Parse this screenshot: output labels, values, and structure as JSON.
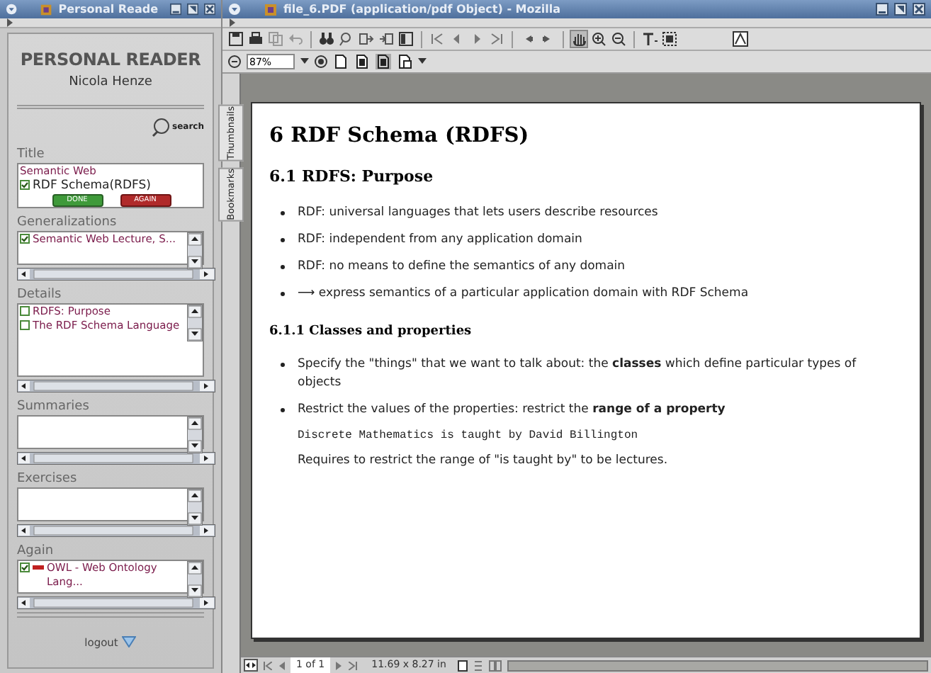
{
  "reader_window": {
    "title": "Personal Reade",
    "app_title": "PERSONAL READER",
    "author": "Nicola Henze",
    "search_label": "search",
    "sections": [
      {
        "heading": "Title",
        "kind": "title",
        "items": [
          {
            "text": "Semantic Web",
            "kind": "plain"
          },
          {
            "text": "RDF Schema(RDFS)",
            "kind": "check",
            "checked": true
          }
        ],
        "buttons": [
          "DONE",
          "AGAIN"
        ]
      },
      {
        "heading": "Generalizations",
        "kind": "list",
        "items": [
          {
            "text": "Semantic Web Lecture, S...",
            "kind": "check",
            "checked": true
          }
        ]
      },
      {
        "heading": "Details",
        "kind": "tall",
        "items": [
          {
            "text": "RDFS: Purpose",
            "kind": "check",
            "checked": false
          },
          {
            "text": "The RDF Schema Language",
            "kind": "check",
            "checked": false
          }
        ]
      },
      {
        "heading": "Summaries",
        "kind": "list"
      },
      {
        "heading": "Exercises",
        "kind": "list"
      },
      {
        "heading": "Again",
        "kind": "list",
        "items": [
          {
            "text": "OWL - Web Ontology Lang...",
            "kind": "flagged",
            "checked": true
          }
        ]
      }
    ],
    "logout": "logout"
  },
  "pdf_window": {
    "title": "file_6.PDF (application/pdf Object) - Mozilla",
    "zoom": "87%",
    "side_tabs": [
      "Thumbnails",
      "Bookmarks"
    ],
    "page": [
      {
        "kind": "h1",
        "text": "6  RDF Schema (RDFS)"
      },
      {
        "kind": "h2",
        "text": "6.1  RDFS: Purpose"
      },
      {
        "kind": "bullet",
        "text": "RDF: universal languages that lets users describe resources"
      },
      {
        "kind": "bullet",
        "text": "RDF: independent from any application domain"
      },
      {
        "kind": "bullet",
        "text": "RDF: no means to define the semantics of any domain"
      },
      {
        "kind": "bullet",
        "text": "⟶ express semantics of a particular application domain with RDF Schema"
      },
      {
        "kind": "h3",
        "text": "6.1.1  Classes and properties"
      },
      {
        "kind": "bullet",
        "text": "Specify the \"things\" that we want to talk about: the **classes** which define particular types of objects"
      },
      {
        "kind": "bullet",
        "text": "Restrict the values of the properties: restrict the **range of a property**"
      },
      {
        "kind": "mono",
        "text": "Discrete Mathematics is taught by David Billington"
      },
      {
        "kind": "para",
        "text": "Requires to restrict the range of \"is taught by\" to be lectures."
      }
    ],
    "status": {
      "page": "1 of 1",
      "size": "11.69 x 8.27 in"
    }
  }
}
